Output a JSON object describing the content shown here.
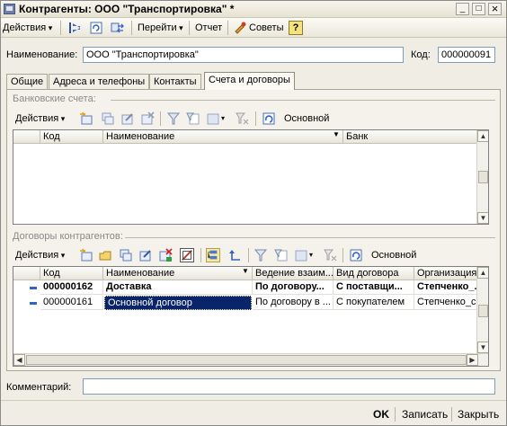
{
  "window": {
    "title": "Контрагенты: ООО \"Транспортировка\" *",
    "controls": {
      "minimize": "_",
      "maximize": "□",
      "close": "×"
    }
  },
  "toolbar": {
    "actions_label": "Действия",
    "goto_label": "Перейти",
    "report_label": "Отчет",
    "tips_label": "Советы",
    "help_label": "?"
  },
  "form": {
    "name_label": "Наименование:",
    "name_value": "ООО \"Транспортировка\"",
    "code_label": "Код:",
    "code_value": "000000091"
  },
  "tabs": [
    {
      "label": "Общие"
    },
    {
      "label": "Адреса и телефоны"
    },
    {
      "label": "Контакты"
    },
    {
      "label": "Счета и договоры",
      "active": true
    }
  ],
  "bank": {
    "group_title": "Банковские счета:",
    "actions_label": "Действия",
    "main_label": "Основной",
    "columns": [
      "Код",
      "Наименование",
      "Банк"
    ]
  },
  "contracts": {
    "group_title": "Договоры контрагентов:",
    "actions_label": "Действия",
    "main_label": "Основной",
    "columns": [
      "Код",
      "Наименование",
      "Ведение взаим...",
      "Вид договора",
      "Организация"
    ],
    "rows": [
      {
        "code": "000000162",
        "name": "Доставка",
        "mode": "По договору...",
        "kind": "С поставщи...",
        "org": "Степченко_...",
        "bold": true
      },
      {
        "code": "000000161",
        "name": "Основной договор",
        "mode": "По договору в ...",
        "kind": "С покупателем",
        "org": "Степченко_с...",
        "selected": true
      }
    ]
  },
  "comment": {
    "label": "Комментарий:",
    "value": ""
  },
  "buttons": {
    "ok": "OK",
    "save": "Записать",
    "close": "Закрыть"
  },
  "colors": {
    "accent": "#2f64c8",
    "selection": "#0a246a"
  }
}
